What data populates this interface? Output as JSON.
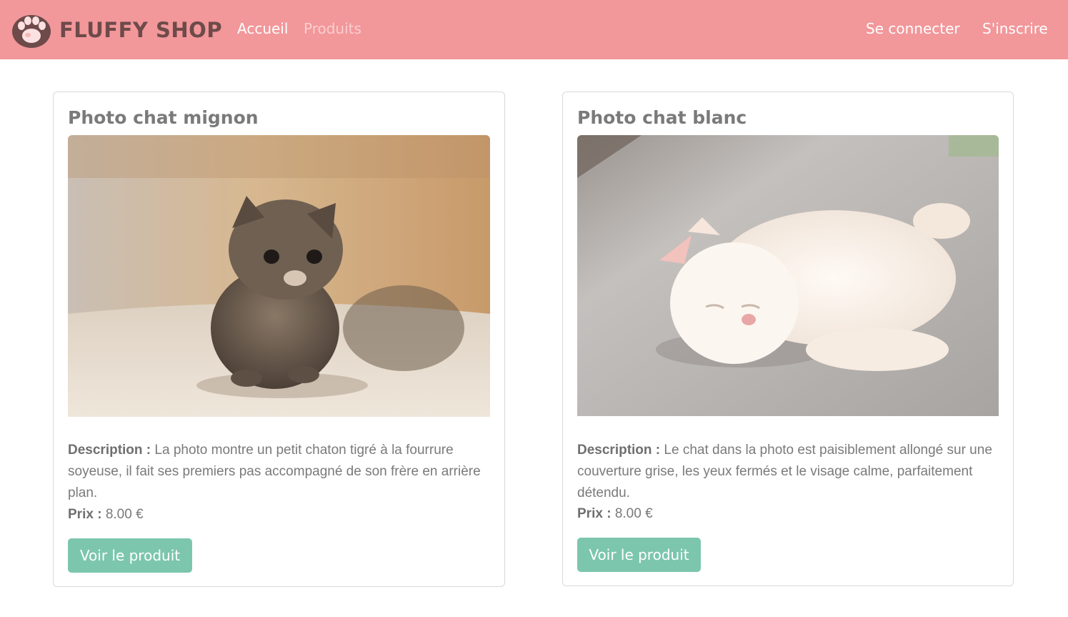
{
  "navbar": {
    "brand": "FLUFFY SHOP",
    "logo_icon": "paw-icon",
    "links": {
      "home": "Accueil",
      "products": "Produits",
      "login": "Se connecter",
      "signup": "S'inscrire"
    },
    "background_color": "#f2979a"
  },
  "products": [
    {
      "title": "Photo chat mignon",
      "image": "tabby-kitten-photo",
      "description_label": "Description :",
      "description": "La photo montre un petit chaton tigré à la fourrure soyeuse, il fait ses premiers pas accompagné de son frère en arrière plan.",
      "price_label": "Prix :",
      "price": "8.00 €",
      "button_label": "Voir le produit"
    },
    {
      "title": "Photo chat blanc",
      "image": "white-kitten-sleeping-photo",
      "description_label": "Description :",
      "description": "Le chat dans la photo est paisiblement allongé sur une couverture grise, les yeux fermés et le visage calme, parfaitement détendu.",
      "price_label": "Prix :",
      "price": "8.00 €",
      "button_label": "Voir le produit"
    }
  ],
  "colors": {
    "button": "#7cc6ae",
    "text": "#7a7a7a"
  }
}
